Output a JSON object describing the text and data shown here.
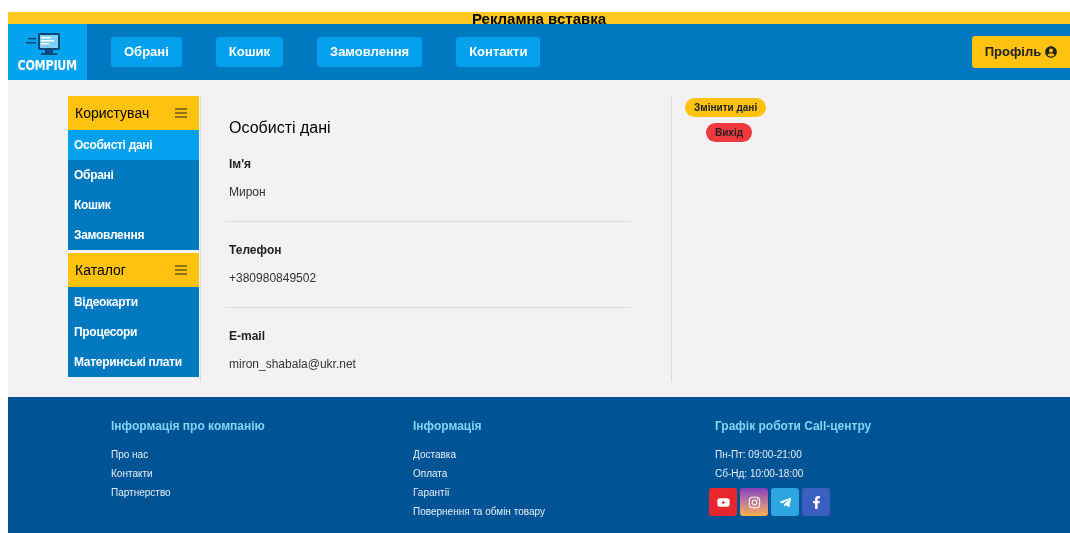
{
  "ad_banner": {
    "text": "Рекламна вставка"
  },
  "header": {
    "logo": {
      "text": "COMPIUM"
    },
    "nav": [
      {
        "label": "Обрані"
      },
      {
        "label": "Кошик"
      },
      {
        "label": "Замовлення"
      },
      {
        "label": "Контакти"
      }
    ],
    "profile_button": {
      "label": "Профіль"
    }
  },
  "sidebar": [
    {
      "title": "Користувач",
      "items": [
        {
          "label": "Особисті дані",
          "selected": true
        },
        {
          "label": "Обрані",
          "selected": false
        },
        {
          "label": "Кошик",
          "selected": false
        },
        {
          "label": "Замовлення",
          "selected": false
        }
      ]
    },
    {
      "title": "Каталог",
      "items": [
        {
          "label": "Відеокарти",
          "selected": false
        },
        {
          "label": "Процесори",
          "selected": false
        },
        {
          "label": "Материнські плати",
          "selected": false
        }
      ]
    }
  ],
  "personal_data": {
    "title": "Особисті дані",
    "fields": [
      {
        "label": "Ім'я",
        "value": "Мирон"
      },
      {
        "label": "Телефон",
        "value": "+380980849502"
      },
      {
        "label": "E-mail",
        "value": "miron_shabala@ukr.net"
      }
    ]
  },
  "actions": [
    {
      "label": "Змінити дані",
      "kind": "edit"
    },
    {
      "label": "Вихід",
      "kind": "logout"
    }
  ],
  "footer": {
    "columns": [
      {
        "title": "Інформація про компанію",
        "links": [
          "Про нас",
          "Контакти",
          "Партнерство"
        ]
      },
      {
        "title": "Інформація",
        "links": [
          "Доставка",
          "Оплата",
          "Гарантії",
          "Повернення та обмін товару"
        ]
      },
      {
        "title": "Графік роботи Call-центру",
        "links": [
          "Пн-Пт: 09:00-21:00",
          "Сб-Нд: 10:00-18:00"
        ]
      }
    ],
    "social": [
      {
        "kind": "video"
      },
      {
        "kind": "camera"
      },
      {
        "kind": "plane"
      },
      {
        "kind": "letter-f"
      }
    ]
  }
}
